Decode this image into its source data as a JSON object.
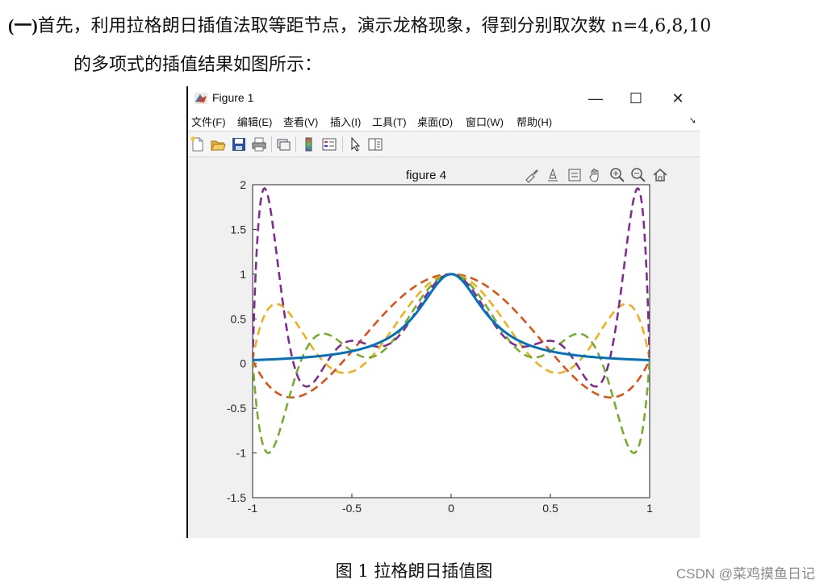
{
  "document": {
    "line1_prefix": "(一)",
    "line1_text": "首先，利用拉格朗日插值法取等距节点，演示龙格现象，得到分别取次数 n=4,6,8,10",
    "line2_text": "的多项式的插值结果如图所示：",
    "caption": "图 1 拉格朗日插值图",
    "watermark": "CSDN @菜鸡摸鱼日记"
  },
  "window": {
    "title": "Figure 1",
    "controls": {
      "minimize": "—",
      "maximize": "☐",
      "close": "✕"
    },
    "menu": [
      "文件(F)",
      "编辑(E)",
      "查看(V)",
      "插入(I)",
      "工具(T)",
      "桌面(D)",
      "窗口(W)",
      "帮助(H)"
    ],
    "toolbar_icons": [
      "new-figure-icon",
      "open-file-icon",
      "save-icon",
      "print-icon",
      "link-plot-icon",
      "colorbar-icon",
      "legend-icon",
      "pointer-icon",
      "property-inspector-icon"
    ],
    "axes_toolbar_icons": [
      "brush-icon",
      "data-tips-icon",
      "export-icon",
      "pan-icon",
      "zoom-in-icon",
      "zoom-out-icon",
      "home-icon"
    ]
  },
  "chart_data": {
    "type": "line",
    "title": "figure 4",
    "xlabel": "",
    "ylabel": "",
    "xlim": [
      -1,
      1
    ],
    "ylim": [
      -1.5,
      2
    ],
    "xticks": [
      "-1",
      "-0.5",
      "0",
      "0.5",
      "1"
    ],
    "yticks": [
      "-1.5",
      "-1",
      "-0.5",
      "0",
      "0.5",
      "1",
      "1.5",
      "2"
    ],
    "grid": false,
    "legend": "none",
    "function": "1/(1+25x^2)",
    "series": [
      {
        "degree": 4,
        "color": "#d95319",
        "style": "dashed"
      },
      {
        "degree": 6,
        "color": "#edb120",
        "style": "dashed"
      },
      {
        "degree": 8,
        "color": "#77ac30",
        "style": "dashed"
      },
      {
        "degree": 10,
        "color": "#7e2f8e",
        "style": "dashed"
      },
      {
        "degree": null,
        "color": "#0072bd",
        "style": "solid"
      }
    ]
  }
}
